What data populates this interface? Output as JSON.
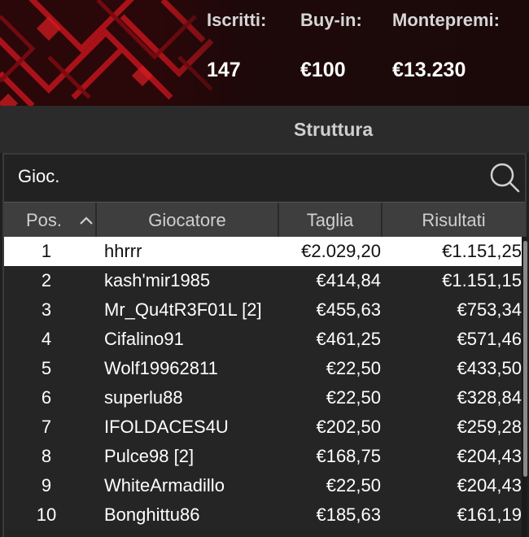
{
  "header": {
    "stats": [
      {
        "label": "Iscritti:",
        "value": "147"
      },
      {
        "label": "Buy-in:",
        "value": "€100"
      },
      {
        "label": "Montepremi:",
        "value": "€13.230"
      }
    ]
  },
  "section": {
    "title": "Struttura"
  },
  "search": {
    "value": "Gioc.",
    "icon": "search-icon"
  },
  "table": {
    "headers": {
      "pos": "Pos.",
      "player": "Giocatore",
      "size": "Taglia",
      "results": "Risultati"
    },
    "sort_icon": "chevron-up-icon",
    "rows": [
      {
        "pos": "1",
        "player": "hhrrr",
        "size": "€2.029,20",
        "result": "€1.151,25"
      },
      {
        "pos": "2",
        "player": "kash'mir1985",
        "size": "€414,84",
        "result": "€1.151,15"
      },
      {
        "pos": "3",
        "player": "Mr_Qu4tR3F01L [2]",
        "size": "€455,63",
        "result": "€753,34"
      },
      {
        "pos": "4",
        "player": "Cifalino91",
        "size": "€461,25",
        "result": "€571,46"
      },
      {
        "pos": "5",
        "player": "Wolf19962811",
        "size": "€22,50",
        "result": "€433,50"
      },
      {
        "pos": "6",
        "player": "superlu88",
        "size": "€22,50",
        "result": "€328,84"
      },
      {
        "pos": "7",
        "player": "IFOLDACES4U",
        "size": "€202,50",
        "result": "€259,28"
      },
      {
        "pos": "8",
        "player": "Pulce98 [2]",
        "size": "€168,75",
        "result": "€204,43"
      },
      {
        "pos": "9",
        "player": "WhiteArmadillo",
        "size": "€22,50",
        "result": "€204,43"
      },
      {
        "pos": "10",
        "player": "Bonghittu86",
        "size": "€185,63",
        "result": "€161,19"
      }
    ]
  },
  "colors": {
    "accent_red": "#c0161c",
    "selected_row": "#ffffff",
    "row_bg": "#252525"
  }
}
